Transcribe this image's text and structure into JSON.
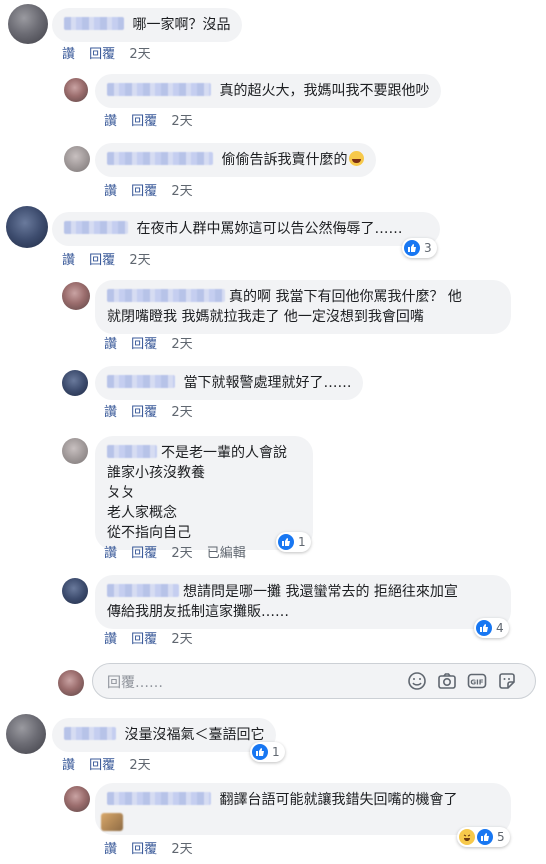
{
  "meta_labels": {
    "like": "讚",
    "reply": "回覆",
    "edited": "已編輯"
  },
  "comments": [
    {
      "text": "哪一家啊？沒品",
      "time": "2天"
    },
    {
      "text": "真的超火大，我媽叫我不要跟他吵",
      "time": "2天"
    },
    {
      "text": "偷偷告訴我賣什麼的",
      "time": "2天"
    },
    {
      "text": "在夜市人群中罵妳這可以告公然侮辱了……",
      "time": "2天",
      "reaction_count": "3"
    },
    {
      "lines": [
        "真的啊 我當下有回他你罵我什麼？ 他",
        "就閉嘴瞪我 我媽就拉我走了 他一定沒想到我會回嘴"
      ],
      "time": "2天"
    },
    {
      "text": "當下就報警處理就好了……",
      "time": "2天"
    },
    {
      "lines": [
        "不是老一輩的人會說",
        "誰家小孩沒教養",
        "ㄆㄆ",
        "老人家概念",
        "從不指向自己"
      ],
      "time": "2天",
      "edited": true,
      "reaction_count": "1"
    },
    {
      "lines": [
        "想請問是哪一攤  我還蠻常去的  拒絕往來加宣",
        "傳給我朋友抵制這家攤販……"
      ],
      "time": "2天",
      "reaction_count": "4"
    },
    {
      "text": "沒量沒福氣＜臺語回它",
      "time": "2天",
      "reaction_count": "1"
    },
    {
      "text": "翻譯台語可能就讓我錯失回嘴的機會了",
      "time": "2天",
      "reaction_count": "5"
    }
  ],
  "reply_input": {
    "placeholder": "回覆……"
  },
  "icons": [
    "like-icon",
    "haha-icon",
    "emoji-icon",
    "camera-icon",
    "gif-icon",
    "sticker-icon"
  ],
  "colors": {
    "bubble": "#f2f3f5",
    "meta": "#606770",
    "like_blue": "#1877f2"
  }
}
